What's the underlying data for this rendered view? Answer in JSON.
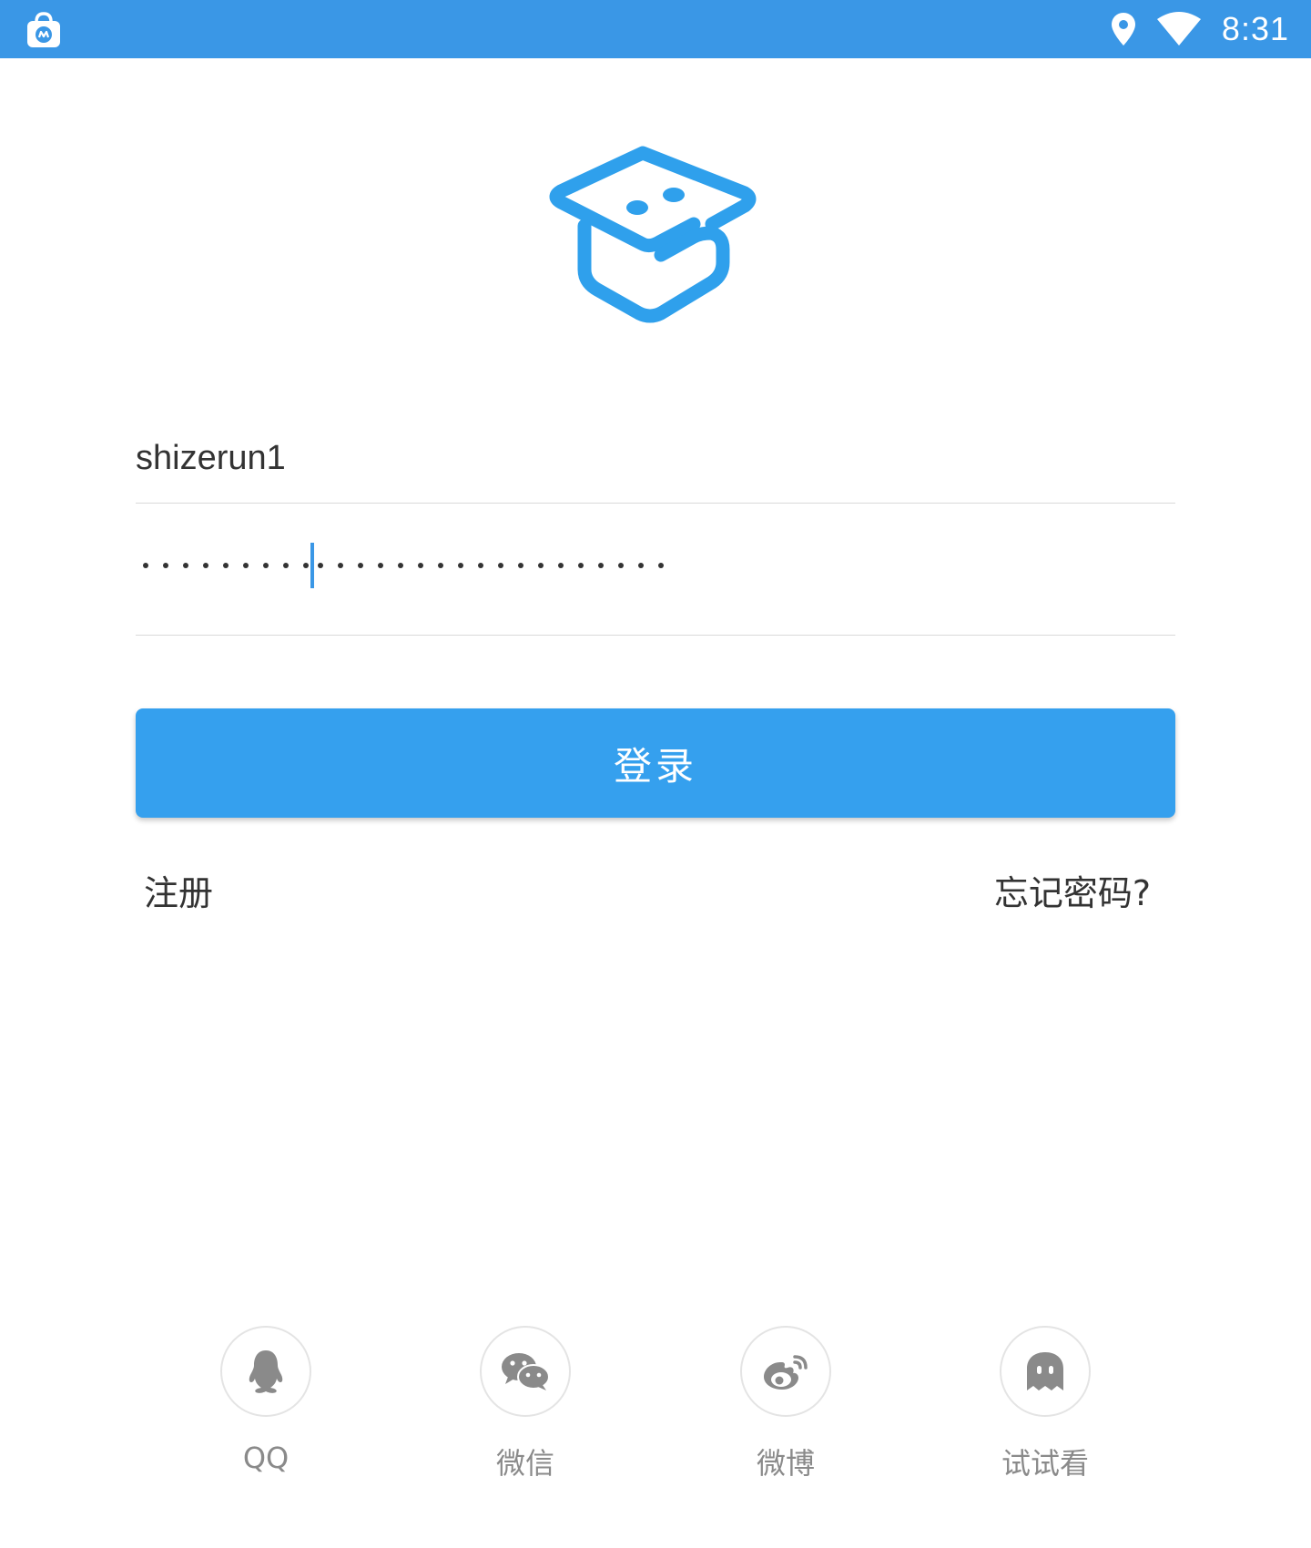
{
  "status_bar": {
    "time": "8:31",
    "bg_color": "#3a97e6",
    "icons": [
      "store-bag-icon",
      "location-pin-icon",
      "wifi-icon"
    ]
  },
  "logo": {
    "icon": "graduation-cap-logo-icon",
    "color": "#2fa0ec"
  },
  "login_form": {
    "username_value": "shizerun1",
    "password_mask_count_before_caret": 9,
    "password_mask_count_after_caret": 18,
    "login_label": "登录",
    "login_color": "#35a0ee"
  },
  "links": {
    "register": "注册",
    "forgot_password": "忘记密码?"
  },
  "social": [
    {
      "label": "QQ",
      "icon": "qq-penguin-icon"
    },
    {
      "label": "微信",
      "icon": "wechat-icon"
    },
    {
      "label": "微博",
      "icon": "weibo-icon"
    },
    {
      "label": "试试看",
      "icon": "ghost-guest-icon"
    }
  ]
}
